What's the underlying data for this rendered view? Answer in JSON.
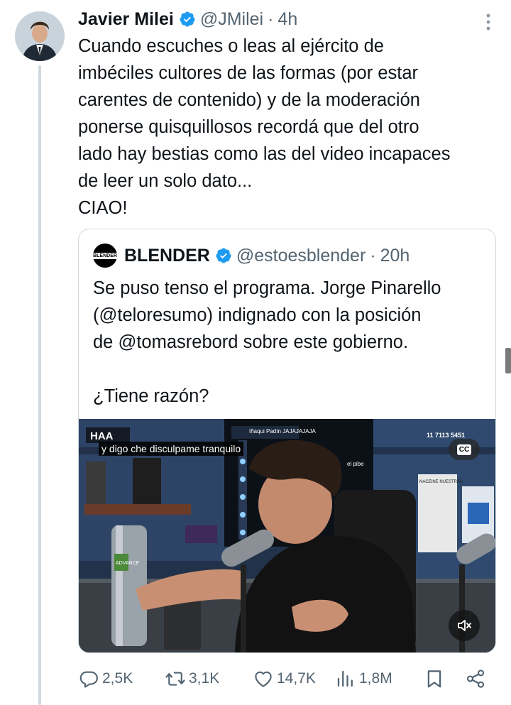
{
  "tweet": {
    "author_name": "Javier Milei",
    "handle": "@JMilei",
    "separator": "·",
    "time": "4h",
    "text_lines": [
      "Cuando escuches o leas al ejército de",
      "imbéciles cultores de las formas (por estar",
      "carentes de contenido) y de la moderación",
      "ponerse quisquillosos recordá que del otro",
      "lado hay bestias como las del video incapaces",
      "de leer un solo dato...",
      "CIAO!"
    ]
  },
  "quote": {
    "avatar_text": "BLENDER",
    "author_name": "BLENDER",
    "handle": "@estoesblender",
    "separator": "·",
    "time": "20h",
    "text_lines": [
      "Se puso tenso el programa. Jorge Pinarello",
      "(@teloresumo) indignado con la posición",
      "de @tomasrebord sobre este gobierno.",
      "",
      "¿Tiene razón?"
    ],
    "video": {
      "subtitle": "y digo che disculpame tranquilo",
      "cc_label": "CC",
      "overlay_texts": [
        "HAA",
        "Iñaqui Padín  JAJAJAJAJA",
        "11 7113 5451",
        "el pibe",
        "ADVANCE",
        "NACEINE NUESTRAS"
      ]
    }
  },
  "actions": {
    "reply_count": "2,5K",
    "retweet_count": "3,1K",
    "like_count": "14,7K",
    "views_count": "1,8M"
  },
  "colors": {
    "text": "#0f1419",
    "secondary": "#536471",
    "verified": "#1d9bf0",
    "border": "#cfd9de"
  }
}
